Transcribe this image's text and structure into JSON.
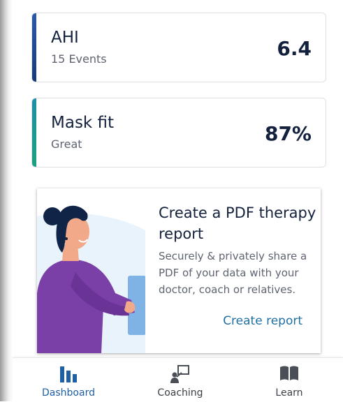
{
  "metrics": [
    {
      "title": "AHI",
      "subtitle": "15 Events",
      "value": "6.4"
    },
    {
      "title": "Mask fit",
      "subtitle": "Great",
      "value": "87%"
    }
  ],
  "promo": {
    "title": "Create a PDF therapy report",
    "body": "Securely & privately share a PDF of your data with your doctor, coach or relatives.",
    "link_label": "Create report"
  },
  "nav": {
    "items": [
      {
        "label": "Dashboard",
        "icon": "bar-chart-icon",
        "active": true
      },
      {
        "label": "Coaching",
        "icon": "coaching-icon",
        "active": false
      },
      {
        "label": "Learn",
        "icon": "book-icon",
        "active": false
      }
    ]
  },
  "colors": {
    "primary_text": "#14213d",
    "secondary_text": "#5e6470",
    "link": "#1f6fa3",
    "nav_active": "#1f5fa3",
    "ahi_accent": "#1f4a93",
    "mask_accent": "#1a9a8c"
  }
}
